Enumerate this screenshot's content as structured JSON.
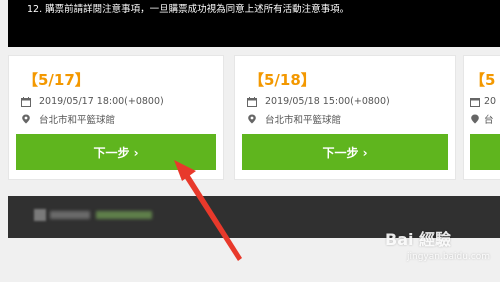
{
  "notice": {
    "text": "12. 購票前請詳閱注意事項，一旦購票成功視為同意上述所有活動注意事項。"
  },
  "events": [
    {
      "title": "【5/17】",
      "datetime": "2019/05/17 18:00(+0800)",
      "venue": "台北市和平籃球館",
      "button_label": "下一步 ›"
    },
    {
      "title": "【5/18】",
      "datetime": "2019/05/18 15:00(+0800)",
      "venue": "台北市和平籃球館",
      "button_label": "下一步 ›"
    },
    {
      "title": "【5",
      "datetime": "20",
      "venue": "台",
      "button_label": ""
    }
  ],
  "icons": {
    "calendar": "calendar-icon",
    "location": "map-pin-icon"
  },
  "colors": {
    "title_orange": "#f39800",
    "button_green": "#5fb51e",
    "notice_bg": "#000000",
    "footer_bg": "#303030",
    "annotation_arrow": "#e8392b"
  },
  "watermark": {
    "brand": "Bai 經驗",
    "url": "jingyan.baidu.com"
  }
}
